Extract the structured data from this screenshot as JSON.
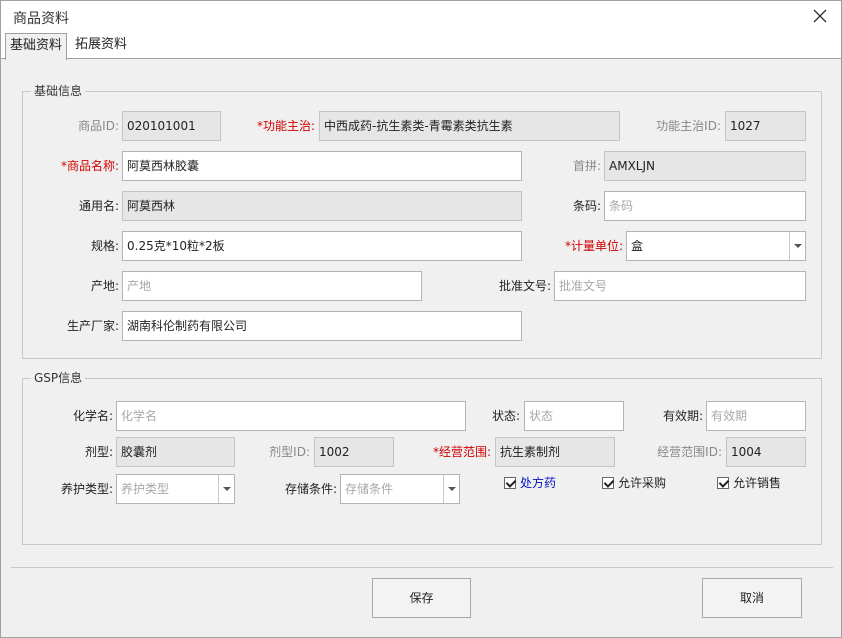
{
  "window": {
    "title": "商品资料"
  },
  "tabs": [
    {
      "label": "基础资料"
    },
    {
      "label": "拓展资料"
    }
  ],
  "basic_info": {
    "legend": "基础信息",
    "product_id": {
      "label": "商品ID:",
      "value": "020101001"
    },
    "indication": {
      "label": "*功能主治:",
      "value": "中西成药-抗生素类-青霉素类抗生素"
    },
    "indication_id": {
      "label": "功能主治ID:",
      "value": "1027"
    },
    "product_name": {
      "label": "*商品名称:",
      "value": "阿莫西林胶囊"
    },
    "pinyin": {
      "label": "首拼:",
      "value": "AMXLJN"
    },
    "generic_name": {
      "label": "通用名:",
      "value": "阿莫西林"
    },
    "barcode": {
      "label": "条码:",
      "placeholder": "条码"
    },
    "spec": {
      "label": "规格:",
      "value": "0.25克*10粒*2板"
    },
    "unit": {
      "label": "*计量单位:",
      "value": "盒"
    },
    "origin": {
      "label": "产地:",
      "placeholder": "产地"
    },
    "approval_no": {
      "label": "批准文号:",
      "placeholder": "批准文号"
    },
    "manufacturer": {
      "label": "生产厂家:",
      "value": "湖南科伦制药有限公司"
    }
  },
  "gsp_info": {
    "legend": "GSP信息",
    "chemical_name": {
      "label": "化学名:",
      "placeholder": "化学名"
    },
    "status": {
      "label": "状态:",
      "placeholder": "状态"
    },
    "validity": {
      "label": "有效期:",
      "placeholder": "有效期"
    },
    "dosage_form": {
      "label": "剂型:",
      "value": "胶囊剂"
    },
    "dosage_form_id": {
      "label": "剂型ID:",
      "value": "1002"
    },
    "business_scope": {
      "label": "*经营范围:",
      "value": "抗生素制剂"
    },
    "business_scope_id": {
      "label": "经营范围ID:",
      "value": "1004"
    },
    "maintenance_type": {
      "label": "养护类型:",
      "placeholder": "养护类型"
    },
    "storage": {
      "label": "存储条件:",
      "placeholder": "存储条件"
    },
    "prescription": {
      "label": "处方药",
      "checked": true,
      "color": "#0010c0"
    },
    "allow_purchase": {
      "label": "允许采购",
      "checked": true
    },
    "allow_sale": {
      "label": "允许销售",
      "checked": true
    }
  },
  "buttons": {
    "save": "保存",
    "cancel": "取消"
  },
  "colors": {
    "required": "#d00000",
    "readonly_bg": "#e6e6e6",
    "placeholder": "#a8a8a8"
  }
}
